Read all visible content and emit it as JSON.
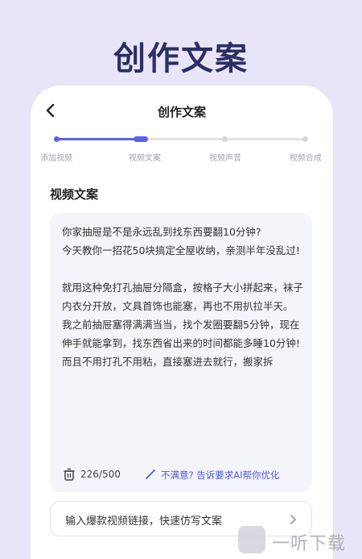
{
  "headline": "创作文案",
  "nav": {
    "title": "创作文案",
    "back_icon": "chevron-left-icon"
  },
  "steps": [
    {
      "label": "添加视频",
      "state": "done"
    },
    {
      "label": "视频文案",
      "state": "current"
    },
    {
      "label": "视频声音",
      "state": "todo"
    },
    {
      "label": "视频合成",
      "state": "todo"
    }
  ],
  "section_title": "视频文案",
  "copy_text": [
    "你家抽屉是不是永远乱到找东西要翻10分钟?",
    "今天教你一招花50块搞定全屋收纳，亲测半年没乱过!",
    "",
    "就用这种免打孔抽屉分隔盒，按格子大小拼起来，袜子内衣分开放，文具首饰也能塞，再也不用扒拉半天。",
    "我之前抽屉塞得满满当当，找个发圈要翻5分钟，现在伸手就能拿到，找东西省出来的时间都能多睡10分钟!",
    "而且不用打孔不用粘，直接塞进去就行，搬家拆"
  ],
  "footer": {
    "counter": "226/500",
    "ai_link": "不满意? 告诉要求AI帮你优化",
    "trash_icon": "trash-icon",
    "wand_icon": "magic-wand-icon"
  },
  "link_bar": {
    "text": "输入爆款视频链接，快速仿写文案",
    "icon": "chevron-right-icon"
  },
  "watermark": {
    "text": "一听下载"
  },
  "colors": {
    "accent": "#5b63e6",
    "headline": "#2c2f63",
    "background": "#e9e5f8"
  }
}
